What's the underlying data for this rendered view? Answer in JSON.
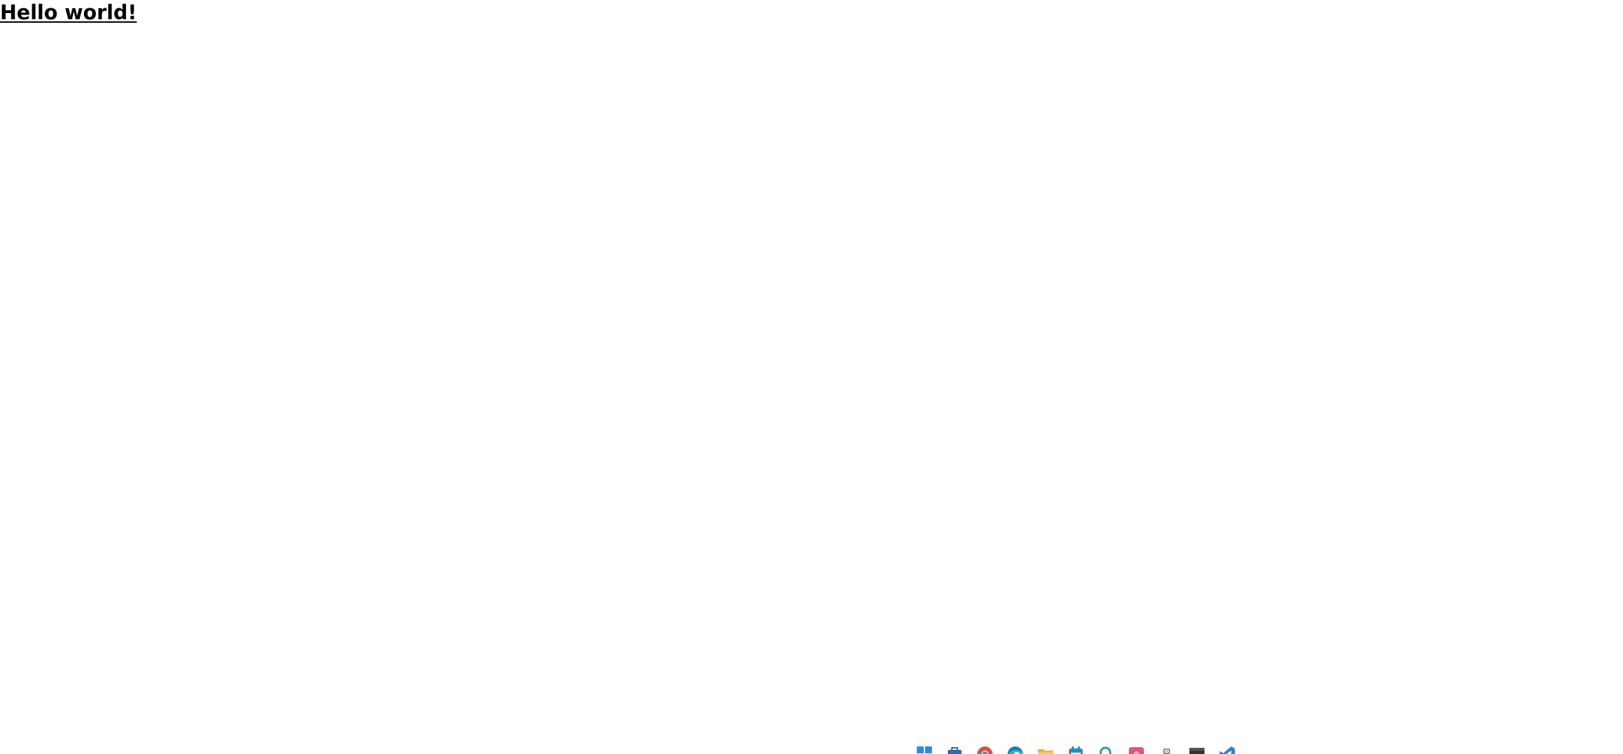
{
  "page": {
    "heading_link": "Hello world!"
  },
  "taskbar": {
    "icons": [
      {
        "name": "windows-start-icon",
        "color": "#1e90e6"
      },
      {
        "name": "store-icon",
        "color": "#2b6cb0"
      },
      {
        "name": "chrome-icon",
        "color": "#e64a3b"
      },
      {
        "name": "edge-icon",
        "color": "#0f7bd6"
      },
      {
        "name": "file-explorer-icon",
        "color": "#e8b830"
      },
      {
        "name": "calendar-icon",
        "color": "#1e90c8"
      },
      {
        "name": "search-app-icon",
        "color": "#1fa0a8"
      },
      {
        "name": "photos-app-icon",
        "color": "#e8508a"
      },
      {
        "name": "small-app-icon",
        "color": "#666666"
      },
      {
        "name": "terminal-icon",
        "color": "#333333"
      },
      {
        "name": "vscode-icon",
        "color": "#1f8ad2"
      }
    ]
  }
}
